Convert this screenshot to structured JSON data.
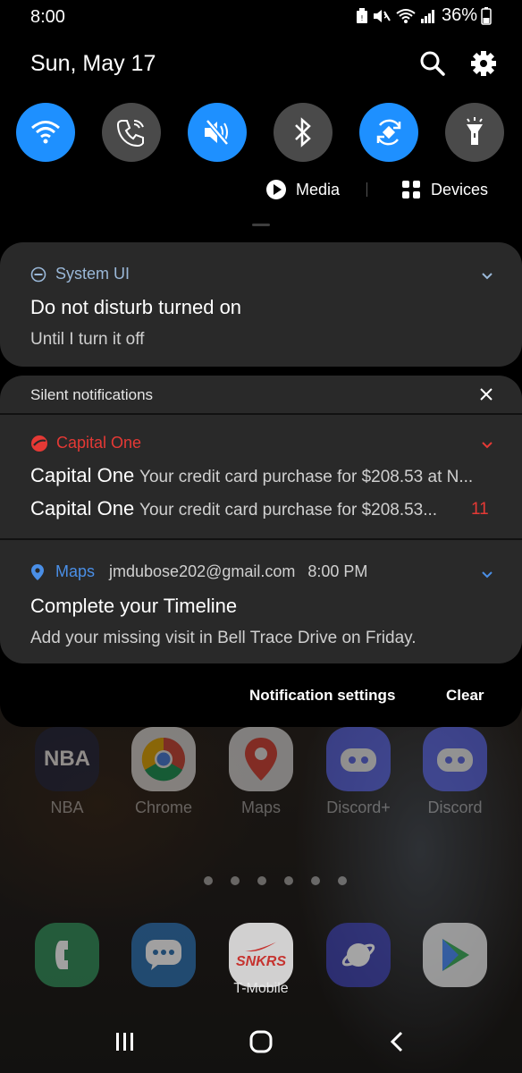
{
  "status_bar": {
    "time": "8:00",
    "battery": "36%",
    "icons": [
      "notification-icon",
      "mute-icon",
      "wifi-icon",
      "signal-icon",
      "battery-icon"
    ]
  },
  "header": {
    "date": "Sun, May 17",
    "icons": [
      "search-icon",
      "settings-icon"
    ]
  },
  "quick_settings": [
    {
      "name": "wifi",
      "icon": "wifi-icon",
      "state": "on"
    },
    {
      "name": "wifi-calling",
      "icon": "wifi-calling-icon",
      "state": "off"
    },
    {
      "name": "mute",
      "icon": "mute-icon",
      "state": "on"
    },
    {
      "name": "bluetooth",
      "icon": "bluetooth-icon",
      "state": "off"
    },
    {
      "name": "auto-rotate",
      "icon": "auto-rotate-icon",
      "state": "on"
    },
    {
      "name": "flashlight",
      "icon": "flashlight-icon",
      "state": "off"
    }
  ],
  "media_row": {
    "media_label": "Media",
    "devices_label": "Devices"
  },
  "dnd_card": {
    "app_name": "System UI",
    "title": "Do not disturb turned on",
    "subtitle": "Until I turn it off"
  },
  "silent": {
    "header": "Silent notifications",
    "capital_one": {
      "app_name": "Capital One",
      "lines": [
        {
          "sender": "Capital One",
          "message": "Your credit card purchase for $208.53 at N..."
        },
        {
          "sender": "Capital One",
          "message": "Your credit card purchase for $208.53...",
          "count": "11"
        }
      ]
    },
    "maps": {
      "app_name": "Maps",
      "account": "jmdubose202@gmail.com",
      "time": "8:00 PM",
      "title": "Complete your Timeline",
      "subtitle": "Add your missing visit in Bell Trace Drive on Friday."
    }
  },
  "footer": {
    "settings_label": "Notification settings",
    "clear_label": "Clear"
  },
  "home_apps_row1": [
    {
      "label": "NBA",
      "badge": "NBA"
    },
    {
      "label": "Chrome"
    },
    {
      "label": "Maps"
    },
    {
      "label": "Discord+"
    },
    {
      "label": "Discord"
    }
  ],
  "dock": {
    "snkrs_text": "SNKRS",
    "folder_label": "T-Mobile"
  },
  "colors": {
    "accent": "#1e90ff",
    "capital_one": "#e53935",
    "maps": "#4a8fe7",
    "shade": "#000000",
    "card": "#292929"
  }
}
